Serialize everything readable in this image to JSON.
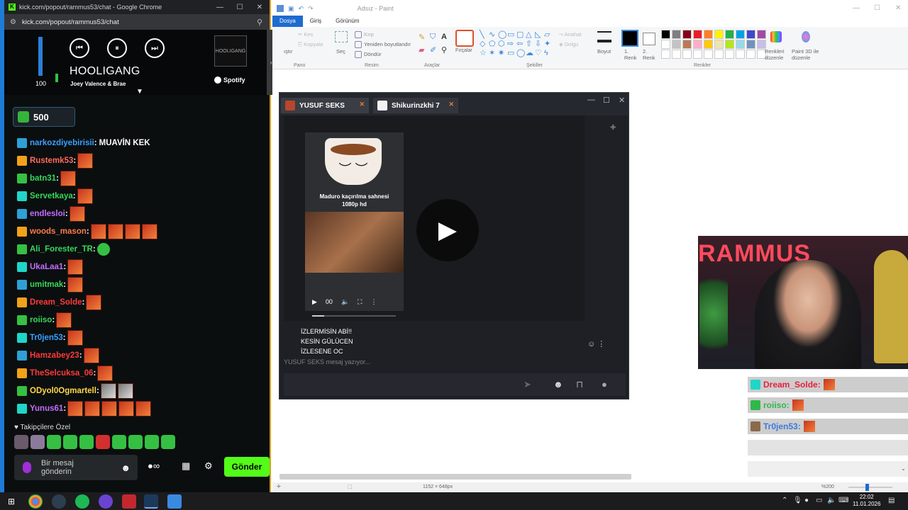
{
  "chrome": {
    "title": "kick.com/popout/rammus53/chat - Google Chrome",
    "url": "kick.com/popout/rammus53/chat",
    "controls": {
      "minimize": "—",
      "maximize": "☐",
      "close": "✕"
    }
  },
  "spotify": {
    "volume": 100,
    "volume_label": "100",
    "song": "HOOLIGANG",
    "artist": "Joey Valence & Brae",
    "brand": "Spotify",
    "cover_text": "HOOLIGANG"
  },
  "points": {
    "value": "500"
  },
  "chat": {
    "messages": [
      {
        "user": "narkozdiyebirisii",
        "color": "#3aa0ff",
        "text": "MUAVİN KEK",
        "emotes": 0
      },
      {
        "user": "Rustemk53",
        "color": "#ff6a5a",
        "text": "",
        "emotes": 1
      },
      {
        "user": "batn31",
        "color": "#35d85a",
        "text": "",
        "emotes": 1
      },
      {
        "user": "Servetkaya",
        "color": "#35d85a",
        "text": "",
        "emotes": 1
      },
      {
        "user": "endlesloi",
        "color": "#c46cff",
        "text": "",
        "emotes": 1
      },
      {
        "user": "woods_mason",
        "color": "#ff7a4a",
        "text": "",
        "emotes": 4
      },
      {
        "user": "Ali_Forester_TR",
        "color": "#35d85a",
        "text": "",
        "emotes": 1,
        "green": true
      },
      {
        "user": "UkaLaa1",
        "color": "#c46cff",
        "text": "",
        "emotes": 1
      },
      {
        "user": "umitmak",
        "color": "#35d85a",
        "text": "",
        "emotes": 1
      },
      {
        "user": "Dream_Solde",
        "color": "#ff3a3a",
        "text": "",
        "emotes": 1
      },
      {
        "user": "roiiso",
        "color": "#35d85a",
        "text": "",
        "emotes": 1
      },
      {
        "user": "Tr0jen53",
        "color": "#3aa0ff",
        "text": "",
        "emotes": 1
      },
      {
        "user": "Hamzabey23",
        "color": "#ff3a3a",
        "text": "",
        "emotes": 1
      },
      {
        "user": "TheSelcuksa_06",
        "color": "#ff3a3a",
        "text": "",
        "emotes": 1
      },
      {
        "user": "ODyol0Ogmartell",
        "color": "#ffd84a",
        "text": "",
        "emotes": 2,
        "photo": true
      },
      {
        "user": "Yunus61",
        "color": "#c46cff",
        "text": "",
        "emotes": 5
      }
    ],
    "followers_label": "Takipçilere Özel",
    "input_placeholder": "Bir mesaj gönderin",
    "send_label": "Gönder"
  },
  "paint": {
    "title": "Adsız - Paint",
    "tabs": [
      "Dosya",
      "Giriş",
      "Görünüm"
    ],
    "groups": {
      "pano": "Pano",
      "resim": "Resim",
      "araclar": "Araçlar",
      "sekiller": "Şekiller",
      "renkler": "Renkler"
    },
    "tools": {
      "yapistir": "ıştır",
      "kes": "Kes",
      "kopyala": "Kopyala",
      "sec": "Seç",
      "kirp": "Kırp",
      "yeniden": "Yeniden boyutlandır",
      "dondur": "Döndür",
      "fircalar": "Fırçalar",
      "anahat": "Anahat",
      "dolgu": "Dolgu",
      "boyut": "Boyut",
      "renk1": "1. Renk",
      "renk2": "2. Renk",
      "renkleri": "Renkleri düzenle",
      "paint3d": "Paint 3D ile düzenle"
    },
    "palette": [
      "#000000",
      "#7f7f7f",
      "#880015",
      "#ed1c24",
      "#ff7f27",
      "#fff200",
      "#22b14c",
      "#00a2e8",
      "#3f48cc",
      "#a349a4",
      "#ffffff",
      "#c3c3c3",
      "#b97a57",
      "#ffaec9",
      "#ffc90e",
      "#efe4b0",
      "#b5e61d",
      "#99d9ea",
      "#7092be",
      "#c8bfe7"
    ],
    "dimensions": "1152 × 648px",
    "zoom": "%200"
  },
  "steam": {
    "tabs": [
      {
        "label": "YUSUF SEKS",
        "avatar_color": "#b8462c"
      },
      {
        "label": "Shikurinzkhi 7",
        "avatar_color": "#f2f2f2"
      }
    ],
    "media": {
      "caption1": "Maduro kaçırılma sahnesi",
      "caption2": "1080p hd",
      "time": "00",
      "progress": 0.14
    },
    "lines": [
      "İZLERMİSİN ABİ!!",
      "KESİN GÜLÜCEN",
      "İZLESENE OC"
    ],
    "typing": "YUSUF SEKS mesaj yazıyor..."
  },
  "overlay": {
    "items": [
      {
        "user": "Dream_Solde:",
        "color": "#e8203a"
      },
      {
        "user": "roiiso:",
        "color": "#2fb84a"
      },
      {
        "user": "Tr0jen53:",
        "color": "#3a7ae0"
      }
    ]
  },
  "taskbar": {
    "time": "22:02",
    "date": "11.01.2026"
  }
}
